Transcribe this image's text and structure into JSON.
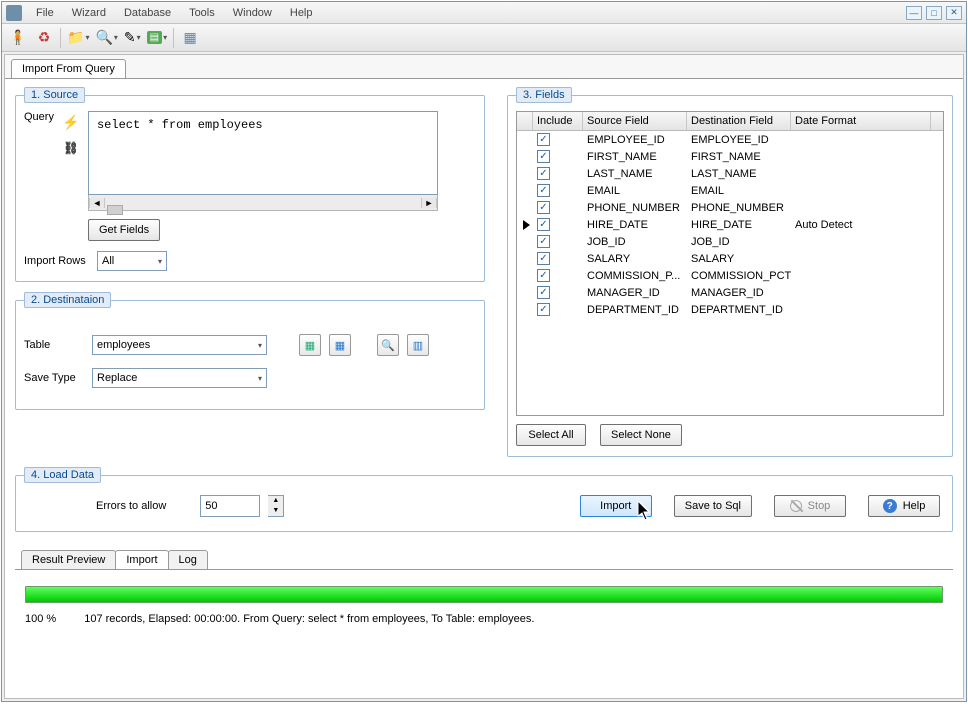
{
  "menu": {
    "items": [
      "File",
      "Wizard",
      "Database",
      "Tools",
      "Window",
      "Help"
    ]
  },
  "page_tab": "Import From Query",
  "source": {
    "legend": "1. Source",
    "query_label": "Query",
    "query_text": "select * from employees",
    "get_fields": "Get Fields",
    "import_rows_label": "Import Rows",
    "import_rows_value": "All"
  },
  "destination": {
    "legend": "2. Destinataion",
    "table_label": "Table",
    "table_value": "employees",
    "save_type_label": "Save Type",
    "save_type_value": "Replace"
  },
  "fields": {
    "legend": "3. Fields",
    "col_include": "Include",
    "col_src": "Source Field",
    "col_dst": "Destination Field",
    "col_fmt": "Date Format",
    "select_all": "Select All",
    "select_none": "Select None",
    "rows": [
      {
        "src": "EMPLOYEE_ID",
        "dst": "EMPLOYEE_ID",
        "fmt": "",
        "marker": false
      },
      {
        "src": "FIRST_NAME",
        "dst": "FIRST_NAME",
        "fmt": "",
        "marker": false
      },
      {
        "src": "LAST_NAME",
        "dst": "LAST_NAME",
        "fmt": "",
        "marker": false
      },
      {
        "src": "EMAIL",
        "dst": "EMAIL",
        "fmt": "",
        "marker": false
      },
      {
        "src": "PHONE_NUMBER",
        "dst": "PHONE_NUMBER",
        "fmt": "",
        "marker": false
      },
      {
        "src": "HIRE_DATE",
        "dst": "HIRE_DATE",
        "fmt": "Auto Detect",
        "marker": true
      },
      {
        "src": "JOB_ID",
        "dst": "JOB_ID",
        "fmt": "",
        "marker": false
      },
      {
        "src": "SALARY",
        "dst": "SALARY",
        "fmt": "",
        "marker": false
      },
      {
        "src": "COMMISSION_P...",
        "dst": "COMMISSION_PCT",
        "fmt": "",
        "marker": false
      },
      {
        "src": "MANAGER_ID",
        "dst": "MANAGER_ID",
        "fmt": "",
        "marker": false
      },
      {
        "src": "DEPARTMENT_ID",
        "dst": "DEPARTMENT_ID",
        "fmt": "",
        "marker": false
      }
    ]
  },
  "load": {
    "legend": "4. Load Data",
    "errors_label": "Errors to allow",
    "errors_value": "50",
    "import_btn": "Import",
    "save_sql_btn": "Save to Sql",
    "stop_btn": "Stop",
    "help_btn": "Help"
  },
  "bottom_tabs": {
    "result": "Result Preview",
    "import": "Import",
    "log": "Log"
  },
  "progress": {
    "percent": "100 %",
    "status": "107 records,   Elapsed: 00:00:00.   From Query: select * from employees,   To Table: employees."
  }
}
